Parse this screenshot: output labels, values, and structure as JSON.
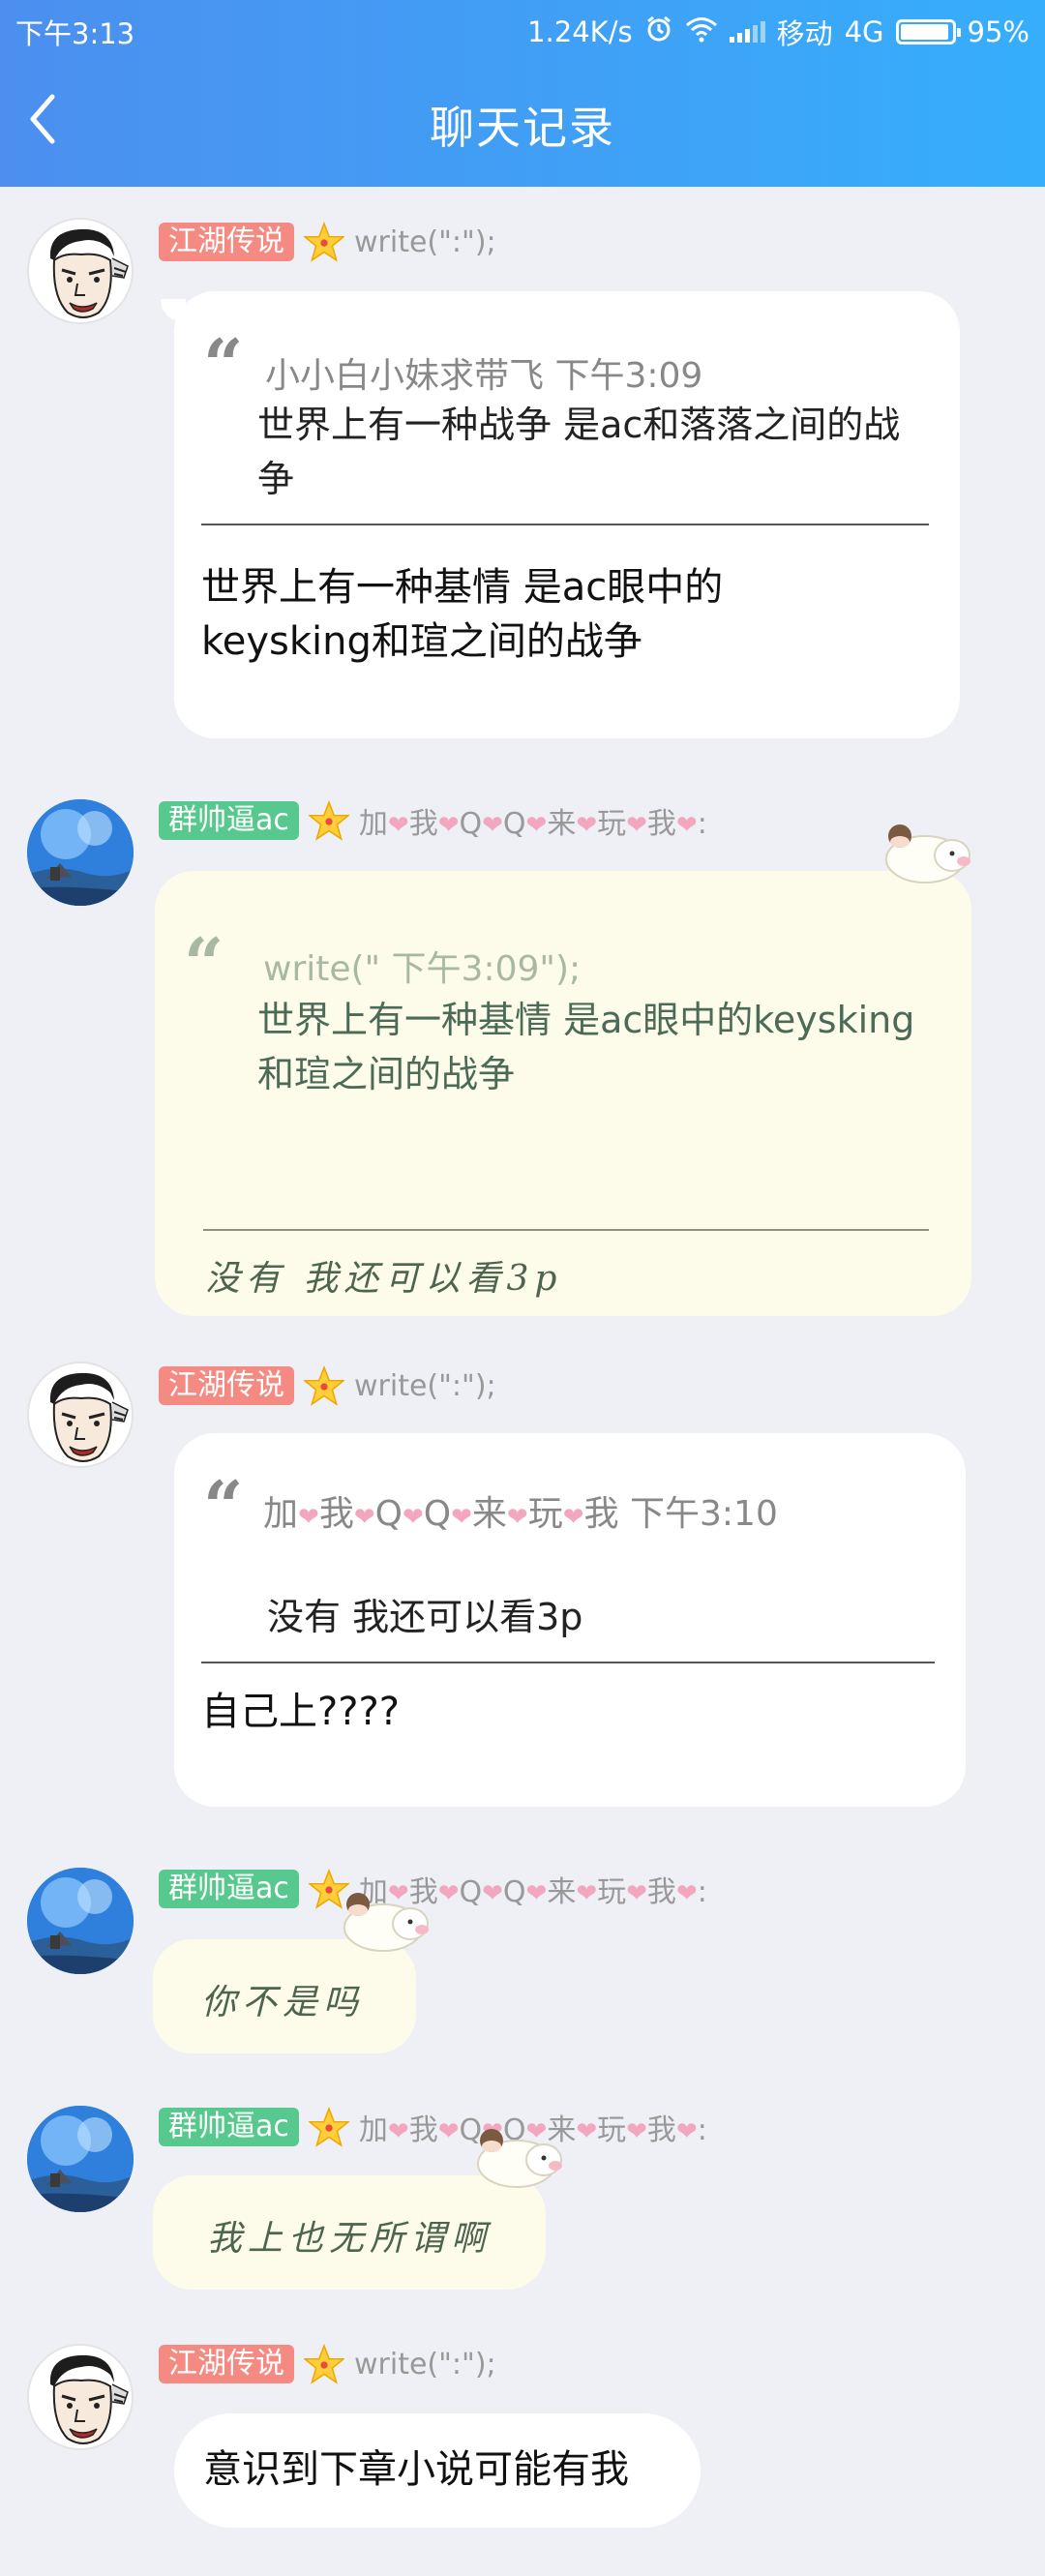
{
  "status_bar": {
    "time": "下午3:13",
    "speed": "1.24K/s",
    "carrier": "移动",
    "network": "4G",
    "battery": "95%",
    "battery_level": 0.95
  },
  "nav": {
    "title": "聊天记录"
  },
  "messages": [
    {
      "sender": "江湖传说",
      "signature": "write(\":\");",
      "quote_author": "小小白小妹求带飞",
      "quote_time": "下午3:09",
      "quote_text": "世界上有一种战争 是ac和落落之间的战争",
      "text": "世界上有一种基情 是ac眼中的keysking和瑄之间的战争"
    },
    {
      "sender": "群帅逼ac",
      "signature_parts": [
        "加",
        "我",
        "Q",
        "Q",
        "来",
        "玩",
        "我",
        ":"
      ],
      "quote_meta": "write(\" 下午3:09\");",
      "quote_text": "世界上有一种基情 是ac眼中的keysking和瑄之间的战争",
      "text": "没有  我还可以看3p"
    },
    {
      "sender": "江湖传说",
      "signature": "write(\":\");",
      "quote_author_parts": [
        "加",
        "我",
        "Q",
        "Q",
        "来",
        "玩",
        "我"
      ],
      "quote_time": "下午3:10",
      "quote_text": "没有  我还可以看3p",
      "text": "自己上????"
    },
    {
      "sender": "群帅逼ac",
      "signature_parts": [
        "加",
        "我",
        "Q",
        "Q",
        "来",
        "玩",
        "我",
        ":"
      ],
      "text": "你不是吗"
    },
    {
      "sender": "群帅逼ac",
      "signature_parts": [
        "加",
        "我",
        "Q",
        "Q",
        "来",
        "玩",
        "我",
        ":"
      ],
      "text": "我上也无所谓啊"
    },
    {
      "sender": "江湖传说",
      "signature": "write(\":\");",
      "text": "意识到下章小说可能有我"
    }
  ],
  "icons": {
    "back": "chevron-left-icon",
    "star": "star-icon",
    "heart": "heart-icon",
    "quote": "quote-icon",
    "alarm": "alarm-icon",
    "wifi": "wifi-icon",
    "signal": "signal-icon",
    "battery": "battery-icon"
  },
  "colors": {
    "header_start": "#4c8fef",
    "header_end": "#36aefb",
    "tag_red": "#f48a82",
    "tag_green": "#58c98e",
    "heart": "#f2a7bf",
    "background": "#eef0f5"
  }
}
